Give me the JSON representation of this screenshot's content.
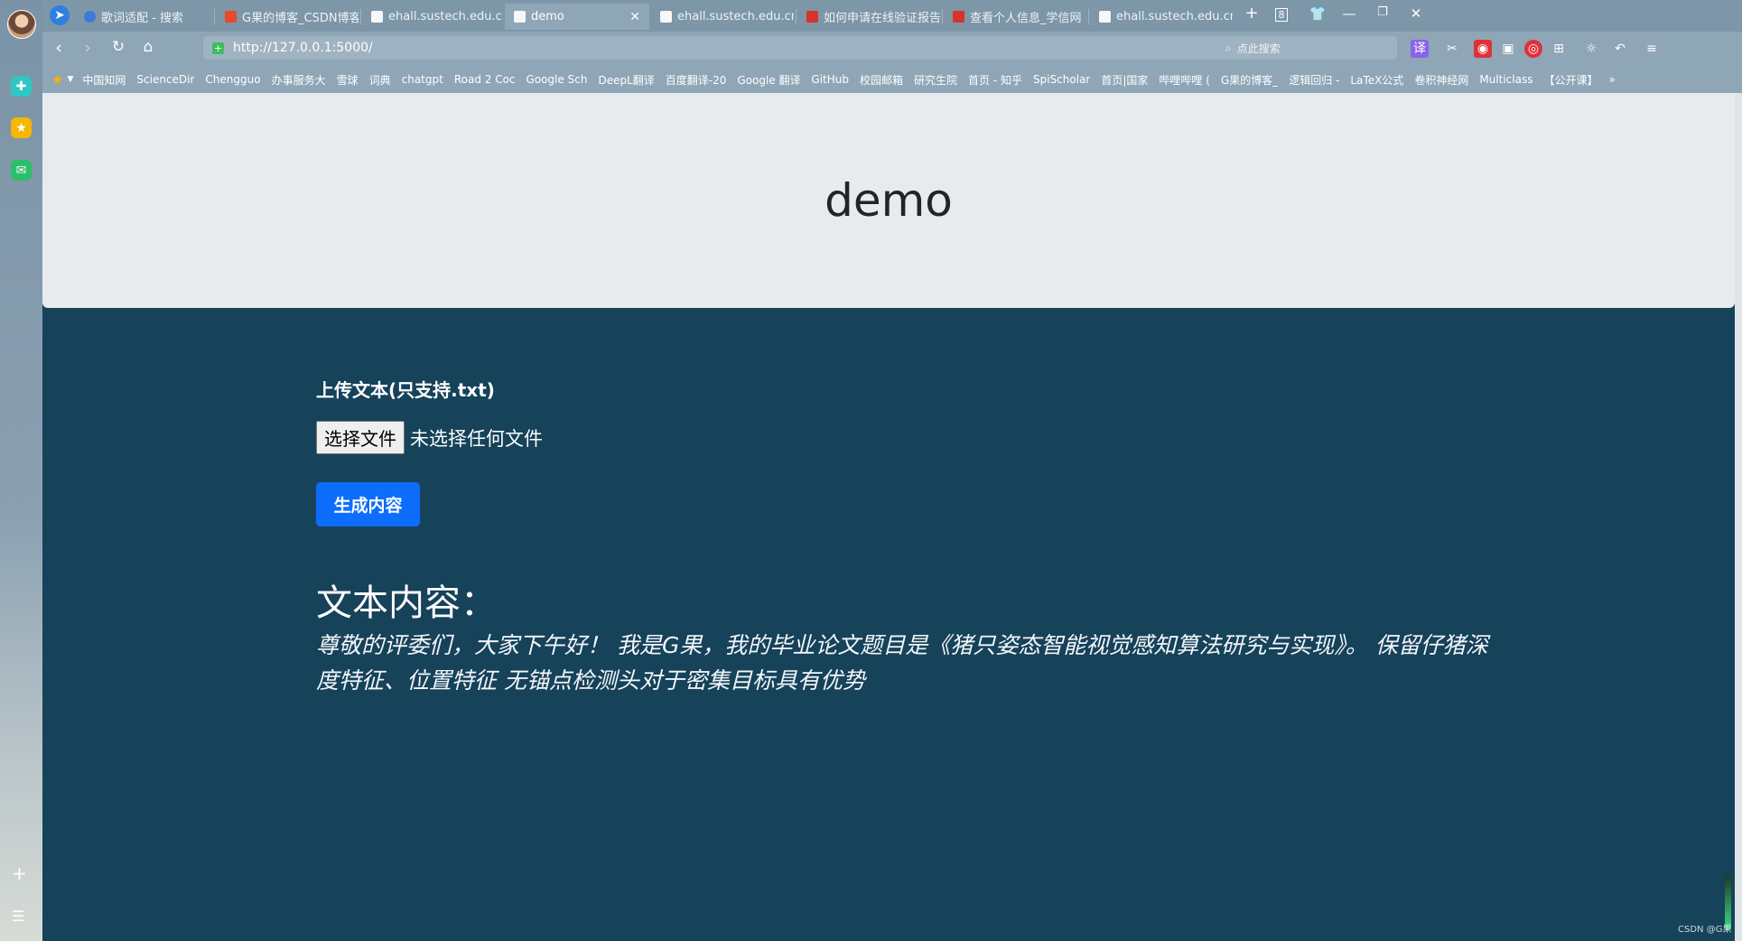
{
  "browser": {
    "tabs": [
      {
        "label": "歌词适配 - 搜索",
        "icon_color": "#3b7bd8"
      },
      {
        "label": "G果的博客_CSDN博客-机",
        "icon_color": "#e8482d"
      },
      {
        "label": "ehall.sustech.edu.cn/rsf",
        "icon_color": "#ffffff"
      },
      {
        "label": "demo",
        "icon_color": "#ffffff",
        "active": true
      },
      {
        "label": "ehall.sustech.edu.cn/rsf",
        "icon_color": "#ffffff"
      },
      {
        "label": "如何申请在线验证报告_中",
        "icon_color": "#d8322d"
      },
      {
        "label": "查看个人信息_学信网",
        "icon_color": "#d8322d"
      },
      {
        "label": "ehall.sustech.edu.cn/rsf",
        "icon_color": "#ffffff"
      }
    ],
    "tab_count": "8",
    "url": "http://127.0.0.1:5000/",
    "search_placeholder": "点此搜索",
    "translate_label": "译",
    "bookmarks": [
      "中国知网",
      "ScienceDir",
      "Chengguo",
      "办事服务大",
      "雪球",
      "词典",
      "chatgpt",
      "Road 2 Coc",
      "Google Sch",
      "DeepL翻译",
      "百度翻译-20",
      "Google 翻译",
      "GitHub",
      "校园邮箱",
      "研究生院",
      "首页 - 知乎",
      "SpiScholar",
      "首页|国家",
      "哔哩哔哩 (",
      "G果的博客_",
      "逻辑回归 - ",
      "LaTeX公式",
      "卷积神经网",
      "Multiclass ",
      "【公开课】",
      "»"
    ]
  },
  "page": {
    "title": "demo",
    "upload_label": "上传文本(只支持.txt)",
    "file_button": "选择文件",
    "file_status": "未选择任何文件",
    "generate_button": "生成内容",
    "section_title": "文本内容：",
    "body_text": "尊敬的评委们，大家下午好！ 我是G果，我的毕业论文题目是《猪只姿态智能视觉感知算法研究与实现》。 保留仔猪深度特征、位置特征 无锚点检测头对于密集目标具有优势"
  },
  "watermark": "CSDN @G果",
  "colors": {
    "page_bg": "#16425a",
    "header_bg": "#e8ebee",
    "primary_button": "#0d6efd"
  }
}
